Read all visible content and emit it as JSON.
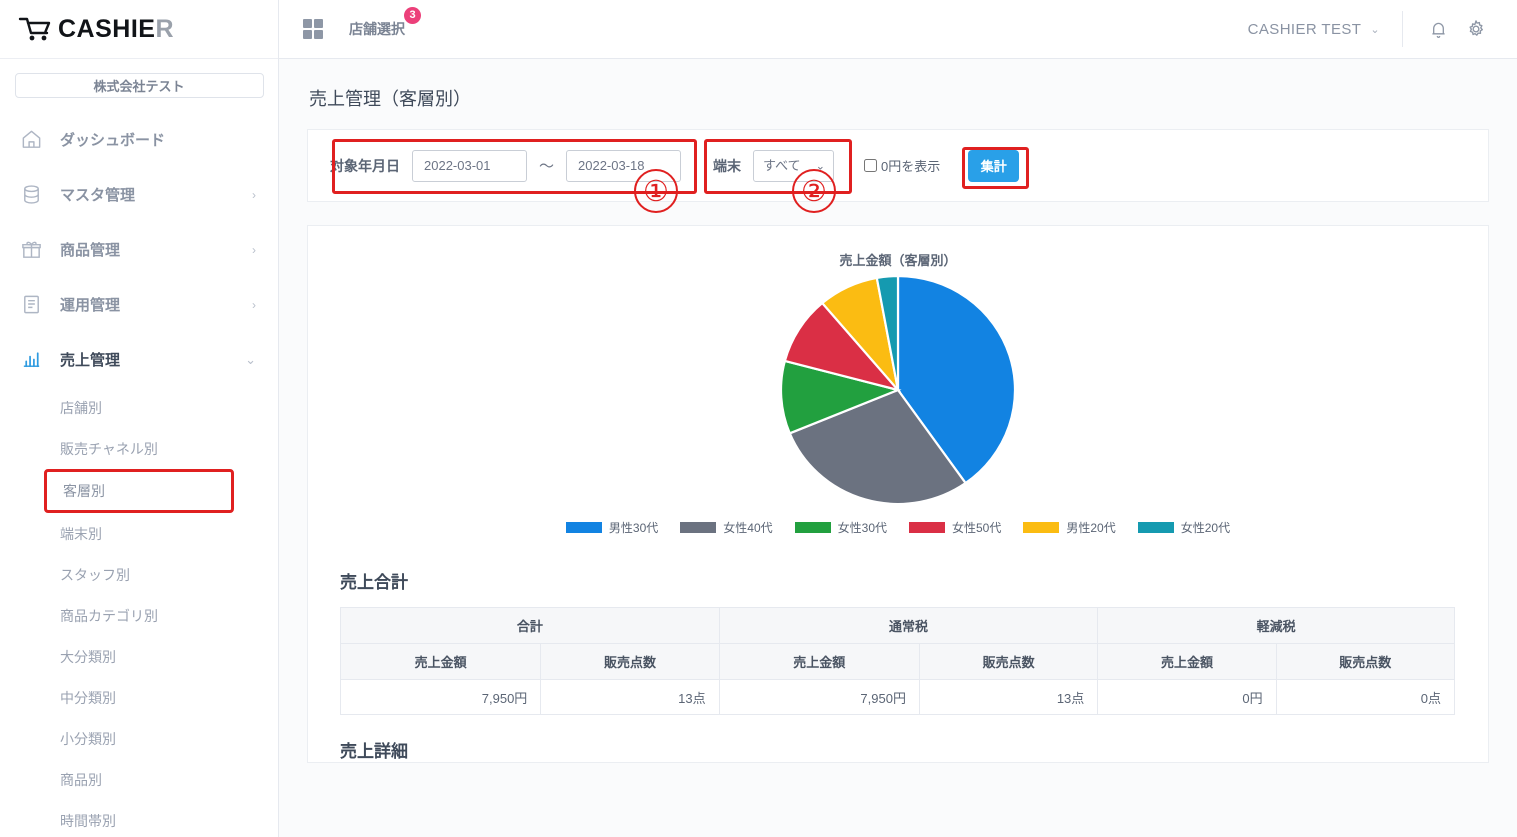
{
  "brand": {
    "name_main": "CASHIE",
    "name_accent": "R"
  },
  "sidebar": {
    "company": "株式会社テスト",
    "items": [
      {
        "label": "ダッシュボード",
        "icon": "home-icon",
        "chevron": ""
      },
      {
        "label": "マスタ管理",
        "icon": "database-icon",
        "chevron": "›"
      },
      {
        "label": "商品管理",
        "icon": "gift-icon",
        "chevron": "›"
      },
      {
        "label": "運用管理",
        "icon": "document-icon",
        "chevron": "›"
      },
      {
        "label": "売上管理",
        "icon": "bar-chart-icon",
        "chevron": "⌄"
      }
    ],
    "subitems": [
      {
        "label": "店舗別"
      },
      {
        "label": "販売チャネル別"
      },
      {
        "label": "客層別"
      },
      {
        "label": "端末別"
      },
      {
        "label": "スタッフ別"
      },
      {
        "label": "商品カテゴリ別"
      },
      {
        "label": "大分類別"
      },
      {
        "label": "中分類別"
      },
      {
        "label": "小分類別"
      },
      {
        "label": "商品別"
      },
      {
        "label": "時間帯別"
      }
    ],
    "highlighted_subitem": "客層別"
  },
  "topbar": {
    "store_select_label": "店舗選択",
    "store_badge": "3",
    "user_name": "CASHIER TEST",
    "user_caret": "⌄",
    "bell_icon": "notification-bell-icon",
    "gear_icon": "settings-gear-icon",
    "grid_icon": "app-grid-icon"
  },
  "page": {
    "title": "売上管理（客層別）"
  },
  "filters": {
    "date_label": "対象年月日",
    "date_from": "2022-03-01",
    "date_to": "2022-03-18",
    "range_separator": "〜",
    "terminal_label": "端末",
    "terminal_value": "すべて",
    "terminal_options": [
      "すべて"
    ],
    "zero_yen_label": "0円を表示",
    "zero_yen_checked": false,
    "aggregate_button": "集計"
  },
  "annotations": [
    {
      "number": "①",
      "target": "date-range-filter"
    },
    {
      "number": "②",
      "target": "terminal-filter"
    }
  ],
  "chart_data": {
    "type": "pie",
    "title": "売上金額（客層別）",
    "categories": [
      "男性30代",
      "女性40代",
      "女性30代",
      "女性50代",
      "男性20代",
      "女性20代"
    ],
    "values": [
      40.2,
      28.6,
      10.3,
      9.7,
      8.3,
      2.9
    ],
    "colors": [
      "#1283e2",
      "#6b7280",
      "#22a03f",
      "#da2f45",
      "#fbbc12",
      "#159ab0"
    ],
    "legend_position": "bottom",
    "labels_shown": false
  },
  "summary": {
    "heading": "売上合計",
    "group_headers": [
      "合計",
      "通常税",
      "軽減税"
    ],
    "sub_headers": [
      "売上金額",
      "販売点数",
      "売上金額",
      "販売点数",
      "売上金額",
      "販売点数"
    ],
    "row": [
      "7,950円",
      "13点",
      "7,950円",
      "13点",
      "0円",
      "0点"
    ]
  },
  "detail": {
    "heading": "売上詳細"
  }
}
